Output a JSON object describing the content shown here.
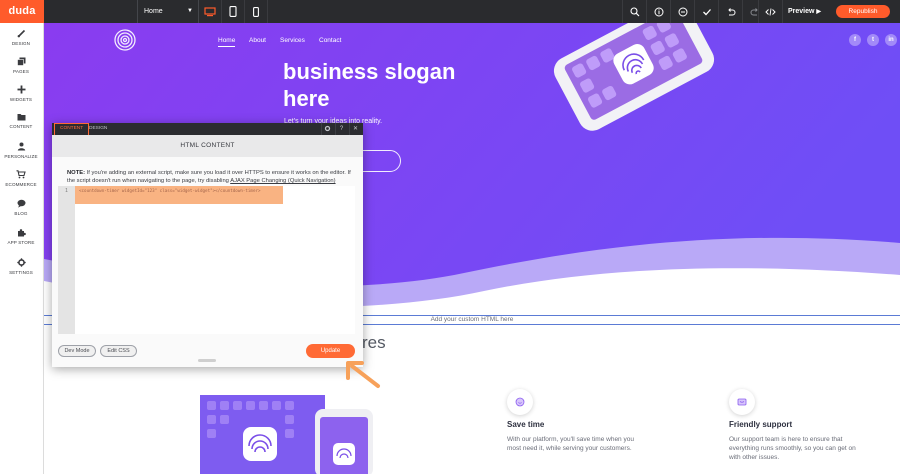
{
  "app": {
    "logo": "duda"
  },
  "toolbar": {
    "page_select": "Home",
    "preview_label": "Preview",
    "republish_label": "Republish",
    "icons": [
      "desktop-icon",
      "tablet-icon",
      "mobile-icon",
      "search-icon",
      "info-icon",
      "zoom-out-icon",
      "check-icon",
      "undo-icon",
      "redo-icon",
      "code-icon"
    ]
  },
  "sidebar": {
    "items": [
      {
        "label": "DESIGN",
        "icon": "brush-icon"
      },
      {
        "label": "PAGES",
        "icon": "pages-icon"
      },
      {
        "label": "WIDGETS",
        "icon": "plus-icon"
      },
      {
        "label": "CONTENT",
        "icon": "folder-icon"
      },
      {
        "label": "PERSONALIZE",
        "icon": "person-icon"
      },
      {
        "label": "ECOMMERCE",
        "icon": "cart-icon"
      },
      {
        "label": "BLOG",
        "icon": "chat-icon"
      },
      {
        "label": "APP STORE",
        "icon": "puzzle-icon"
      },
      {
        "label": "SETTINGS",
        "icon": "gear-icon"
      }
    ]
  },
  "site": {
    "nav": [
      "Home",
      "About",
      "Services",
      "Contact"
    ],
    "social": [
      "f",
      "t",
      "in"
    ],
    "slogan": "business slogan here",
    "subtext": "Let's turn your ideas into reality.",
    "custom_html_placeholder": "Add your custom HTML here",
    "features_title_fragment": "res",
    "features": [
      {
        "title": "Save time",
        "desc": "With our platform, you'll save time when you most need it, while serving your customers."
      },
      {
        "title": "Friendly support",
        "desc": "Our support team is here to ensure that everything runs smoothly, so you can get on with other issues."
      }
    ]
  },
  "dialog": {
    "tabs": [
      "CONTENT",
      "DESIGN"
    ],
    "header_icons": [
      "gear-icon",
      "help-icon",
      "close-icon"
    ],
    "help_glyph": "?",
    "close_glyph": "✕",
    "title": "HTML CONTENT",
    "note_bold": "NOTE:",
    "note_text": " If you're adding an external script, make sure you load it over HTTPS to ensure it works on the editor. If the script doesn't run when navigating to the page, try disabling ",
    "note_link": "AJAX Page Changing (Quick Navigation)",
    "line_number": "1",
    "code": "<countdown-timer widgetId=\"123\" class=\"widget-widget\"></countdown-timer>",
    "dev_mode_label": "Dev Mode",
    "edit_css_label": "Edit CSS",
    "update_label": "Update"
  },
  "colors": {
    "accent": "#ff5b2b",
    "hero_purple": "#7b46f4",
    "toolbar_bg": "#2a2b2e",
    "code_highlight": "#f9b382"
  }
}
